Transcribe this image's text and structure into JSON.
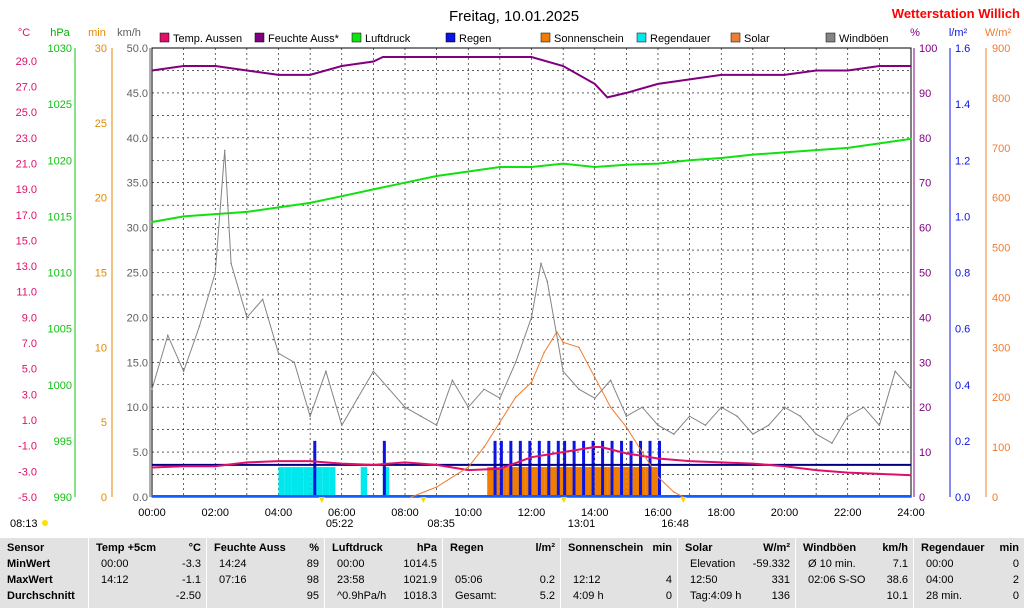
{
  "title": "Freitag, 10.01.2025",
  "station": "Wetterstation Willich",
  "colors": {
    "temp": "#e0106a",
    "humidity": "#800080",
    "pressure": "#11e011",
    "rain": "#0b14e0",
    "sunshine": "#f07c00",
    "rain_duration": "#00e8ee",
    "solar": "#f07c30",
    "gust": "#848484",
    "stat_bg": "#e2e2e2"
  },
  "legend": [
    {
      "label": "Temp. Aussen",
      "color": "#e0106a",
      "kind": "box"
    },
    {
      "label": "Feuchte Auss*",
      "color": "#800080",
      "kind": "box"
    },
    {
      "label": "Luftdruck",
      "color": "#11e011",
      "kind": "box"
    },
    {
      "label": "Regen",
      "color": "#0b14e0",
      "kind": "box"
    },
    {
      "label": "Sonnenschein",
      "color": "#f07c00",
      "kind": "box"
    },
    {
      "label": "Regendauer",
      "color": "#00e8ee",
      "kind": "box"
    },
    {
      "label": "Solar",
      "color": "#f07c30",
      "kind": "box"
    },
    {
      "label": "Windböen",
      "color": "#848484",
      "kind": "box"
    }
  ],
  "axis_units": {
    "temp": "°C",
    "pressure": "hPa",
    "minutes": "min",
    "wind": "km/h",
    "humidity": "%",
    "rain": "l/m²",
    "solar": "W/m²"
  },
  "sun_events": {
    "sunrise": "08:13",
    "sunset": "16:48",
    "markers": [
      {
        "label": "05:22",
        "time": 5.37
      },
      {
        "label": "08:35",
        "time": 8.58
      },
      {
        "label": "13:01",
        "time": 13.02
      },
      {
        "label": "16:48",
        "time": 16.8
      }
    ]
  },
  "chart_data": {
    "type": "line",
    "xlabel": "",
    "x_ticks": [
      "00:00",
      "02:00",
      "04:00",
      "06:00",
      "08:00",
      "10:00",
      "12:00",
      "14:00",
      "16:00",
      "18:00",
      "20:00",
      "22:00",
      "24:00"
    ],
    "xlim": [
      0,
      24
    ],
    "axes": {
      "temp_c": {
        "ticks": [
          "29.0",
          "27.0",
          "25.0",
          "23.0",
          "21.0",
          "19.0",
          "17.0",
          "15.0",
          "13.0",
          "11.0",
          "9.0",
          "7.0",
          "5.0",
          "3.0",
          "1.0",
          "-1.0",
          "-3.0",
          "-5.0"
        ],
        "ylim": [
          -5,
          30
        ]
      },
      "pressure_hpa": {
        "ticks": [
          "1030",
          "1025",
          "1020",
          "1015",
          "1010",
          "1005",
          "1000",
          "995",
          "990"
        ],
        "ylim": [
          990,
          1030
        ]
      },
      "minutes": {
        "ticks": [
          "30",
          "25",
          "20",
          "15",
          "10",
          "5",
          "0"
        ],
        "ylim": [
          0,
          30
        ]
      },
      "wind_kmh": {
        "ticks": [
          "50.0",
          "45.0",
          "40.0",
          "35.0",
          "30.0",
          "25.0",
          "20.0",
          "15.0",
          "10.0",
          "5.0",
          "0.0"
        ],
        "ylim": [
          0,
          50
        ]
      },
      "humidity_pct": {
        "ticks": [
          "100",
          "90",
          "80",
          "70",
          "60",
          "50",
          "40",
          "30",
          "20",
          "10",
          "0"
        ],
        "ylim": [
          0,
          100
        ]
      },
      "rain_lm2": {
        "ticks": [
          "1.6",
          "1.4",
          "1.2",
          "1.0",
          "0.8",
          "0.6",
          "0.4",
          "0.2",
          "0.0"
        ],
        "ylim": [
          0,
          1.6
        ]
      },
      "solar_wm2": {
        "ticks": [
          "900",
          "800",
          "700",
          "600",
          "500",
          "400",
          "300",
          "200",
          "100",
          "0"
        ],
        "ylim": [
          0,
          900
        ]
      }
    },
    "series": [
      {
        "name": "Temp. Aussen",
        "axis": "temp_c",
        "color": "#e0106a",
        "x": [
          0,
          1,
          2,
          3,
          4,
          5,
          6,
          7,
          8,
          9,
          10,
          11,
          12,
          13,
          14,
          14.2,
          15,
          16,
          17,
          18,
          19,
          20,
          21,
          22,
          23,
          24
        ],
        "y": [
          -2.7,
          -2.6,
          -2.6,
          -2.3,
          -2.2,
          -2.2,
          -2.4,
          -2.5,
          -2.3,
          -2.5,
          -2.9,
          -2.8,
          -1.9,
          -1.5,
          -1.1,
          -1.1,
          -1.6,
          -2.0,
          -2.2,
          -2.3,
          -2.4,
          -2.6,
          -2.9,
          -3.1,
          -3.2,
          -3.3
        ]
      },
      {
        "name": "Feuchte Auss*",
        "axis": "humidity_pct",
        "color": "#800080",
        "x": [
          0,
          1,
          2,
          3,
          4,
          5,
          6,
          7,
          7.3,
          8,
          9,
          10,
          11,
          12,
          13,
          14,
          14.4,
          15,
          16,
          17,
          18,
          19,
          20,
          21,
          22,
          23,
          24
        ],
        "y": [
          95,
          96,
          96,
          95,
          94,
          94,
          96,
          97,
          98,
          98,
          98,
          98,
          98,
          98,
          96,
          92,
          89,
          90,
          92,
          93,
          94,
          94,
          94,
          95,
          95,
          96,
          96
        ]
      },
      {
        "name": "Luftdruck",
        "axis": "pressure_hpa",
        "color": "#11e011",
        "x": [
          0,
          1,
          2,
          3,
          4,
          5,
          6,
          7,
          8,
          9,
          10,
          11,
          12,
          13,
          14,
          15,
          16,
          17,
          18,
          19,
          20,
          21,
          22,
          23,
          24
        ],
        "y": [
          1014.5,
          1015.0,
          1015.2,
          1015.4,
          1015.8,
          1016.2,
          1016.8,
          1017.4,
          1018.0,
          1018.6,
          1019.0,
          1019.4,
          1019.4,
          1019.7,
          1019.4,
          1019.6,
          1019.7,
          1020.0,
          1020.2,
          1020.5,
          1020.7,
          1020.9,
          1021.1,
          1021.5,
          1021.9
        ]
      },
      {
        "name": "Solar",
        "axis": "solar_wm2",
        "color": "#f07c30",
        "x": [
          8.2,
          9,
          10,
          10.5,
          11,
          11.5,
          12,
          12.4,
          12.8,
          13,
          13.5,
          14,
          14.5,
          15,
          15.5,
          16,
          16.5,
          16.8
        ],
        "y": [
          0,
          20,
          60,
          100,
          150,
          200,
          230,
          290,
          331,
          310,
          300,
          240,
          180,
          140,
          90,
          40,
          10,
          0
        ]
      },
      {
        "name": "Windböen",
        "axis": "wind_kmh",
        "color": "#848484",
        "x": [
          0,
          0.5,
          1,
          1.5,
          2,
          2.3,
          2.5,
          3,
          3.5,
          4,
          4.5,
          5,
          5.5,
          6,
          6.5,
          7,
          7.5,
          8,
          8.5,
          9,
          9.5,
          10,
          10.5,
          11,
          11.5,
          12,
          12.3,
          12.5,
          13,
          13.5,
          14,
          14.5,
          15,
          15.5,
          16,
          16.5,
          17,
          17.5,
          18,
          18.5,
          19,
          19.5,
          20,
          20.5,
          21,
          21.5,
          22,
          22.5,
          23,
          23.5,
          24
        ],
        "y": [
          12,
          18,
          14,
          19,
          25,
          38.6,
          26,
          20,
          22,
          16,
          15,
          9,
          14,
          8,
          11,
          14,
          12,
          10,
          9,
          8,
          13,
          10,
          12,
          11,
          15,
          20,
          26,
          24,
          14,
          12,
          11,
          13,
          9,
          10,
          8,
          7,
          9,
          8,
          10,
          9,
          7,
          8,
          10,
          9,
          7,
          6,
          9,
          10,
          8,
          14,
          12
        ]
      },
      {
        "name": "Regendauer",
        "axis": "minutes",
        "type": "bar",
        "color": "#00e8ee",
        "x": [
          4.0,
          4.2,
          4.4,
          4.6,
          4.8,
          5.0,
          5.2,
          5.4,
          5.6,
          6.6,
          7.3
        ],
        "y": [
          2,
          2,
          2,
          2,
          2,
          2,
          2,
          2,
          2,
          2,
          2
        ]
      },
      {
        "name": "Sonnenschein",
        "axis": "minutes",
        "type": "bar",
        "color": "#f07c00",
        "x": [
          10.6,
          10.8,
          11.0,
          11.2,
          11.4,
          11.6,
          11.8,
          12.0,
          12.2,
          12.4,
          12.6,
          12.8,
          13.0,
          13.2,
          13.4,
          13.6,
          13.8,
          14.0,
          14.2,
          14.4,
          14.6,
          14.8,
          15.0,
          15.2,
          15.4,
          15.6,
          15.8
        ],
        "y": [
          2,
          2,
          2,
          2,
          2,
          2,
          2,
          2,
          2,
          2,
          2,
          2,
          2,
          2,
          2,
          2,
          2,
          2,
          2,
          2,
          2,
          2,
          2,
          2,
          2,
          2,
          2
        ]
      },
      {
        "name": "Regen",
        "axis": "rain_lm2",
        "type": "bar",
        "color": "#0b14e0",
        "x": [
          5.1,
          7.3,
          10.8,
          11.0,
          11.3,
          11.6,
          11.9,
          12.2,
          12.5,
          12.8,
          13.0,
          13.3,
          13.6,
          13.9,
          14.2,
          14.5,
          14.8,
          15.1,
          15.4,
          15.7,
          16.0
        ],
        "y": [
          0.2,
          0.2,
          0.2,
          0.2,
          0.2,
          0.2,
          0.2,
          0.2,
          0.2,
          0.2,
          0.2,
          0.2,
          0.2,
          0.2,
          0.2,
          0.2,
          0.2,
          0.2,
          0.2,
          0.2,
          0.2
        ]
      }
    ],
    "reference_line": {
      "name": "Temp. Aussen mean",
      "axis": "temp_c",
      "y": -2.5,
      "color": "#000080"
    },
    "solar_baseline": {
      "axis": "rain_lm2",
      "y": 0,
      "color": "#1060ff"
    }
  },
  "stats": {
    "columns": [
      {
        "title": "Sensor",
        "unit": "",
        "rows": [
          [
            "MinWert",
            ""
          ],
          [
            "MaxWert",
            ""
          ],
          [
            "Durchschnitt",
            ""
          ]
        ]
      },
      {
        "title": "Temp +5cm",
        "unit": "°C",
        "rows": [
          [
            "00:00",
            "-3.3"
          ],
          [
            "14:12",
            "-1.1"
          ],
          [
            "",
            "-2.50"
          ]
        ]
      },
      {
        "title": "Feuchte Auss",
        "unit": "%",
        "rows": [
          [
            "14:24",
            "89"
          ],
          [
            "07:16",
            "98"
          ],
          [
            "",
            "95"
          ]
        ]
      },
      {
        "title": "Luftdruck",
        "unit": "hPa",
        "rows": [
          [
            "00:00",
            "1014.5"
          ],
          [
            "23:58",
            "1021.9"
          ],
          [
            "^0.9hPa/h",
            "1018.3"
          ]
        ]
      },
      {
        "title": "Regen",
        "unit": "l/m²",
        "rows": [
          [
            "",
            ""
          ],
          [
            "05:06",
            "0.2"
          ],
          [
            "Gesamt:",
            "5.2"
          ]
        ]
      },
      {
        "title": "Sonnenschein",
        "unit": "min",
        "rows": [
          [
            "",
            ""
          ],
          [
            "12:12",
            "4"
          ],
          [
            "4:09 h",
            "0"
          ]
        ]
      },
      {
        "title": "Solar",
        "unit": "W/m²",
        "rows": [
          [
            "Elevation",
            "-59.332"
          ],
          [
            "12:50",
            "331"
          ],
          [
            "Tag:4:09 h",
            "136"
          ]
        ]
      },
      {
        "title": "Windböen",
        "unit": "km/h",
        "rows": [
          [
            "Ø 10 min.",
            "7.1"
          ],
          [
            "02:06  S-SO",
            "38.6"
          ],
          [
            "",
            "10.1"
          ]
        ]
      },
      {
        "title": "Regendauer",
        "unit": "min",
        "rows": [
          [
            "00:00",
            "0"
          ],
          [
            "04:00",
            "2"
          ],
          [
            "28 min.",
            "0"
          ]
        ]
      }
    ]
  }
}
